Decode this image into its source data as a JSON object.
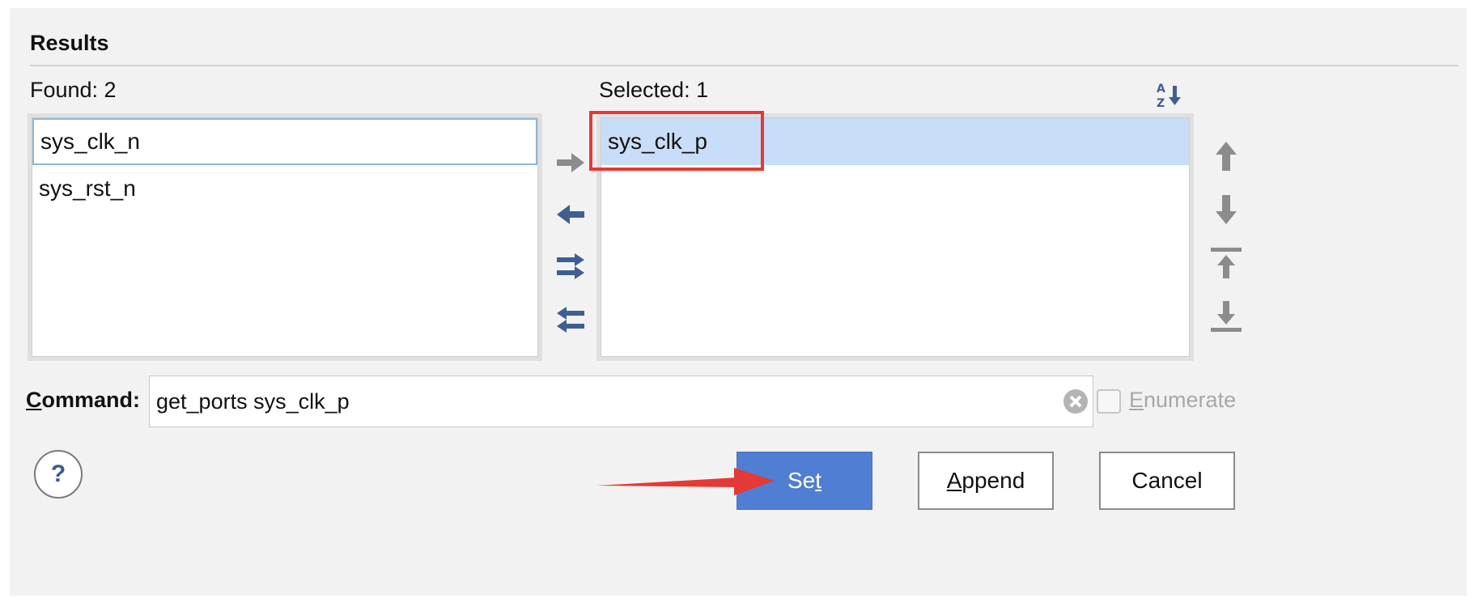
{
  "results": {
    "title": "Results",
    "found": {
      "label": "Found: 2",
      "items": [
        "sys_clk_n",
        "sys_rst_n"
      ]
    },
    "selected": {
      "label": "Selected: 1",
      "items": [
        "sys_clk_p"
      ]
    }
  },
  "command": {
    "label_prefix": "C",
    "label_rest": "ommand:",
    "value": "get_ports sys_clk_p",
    "enumerate": {
      "label_prefix": "E",
      "label_rest": "numerate",
      "checked": false
    }
  },
  "buttons": {
    "help": "?",
    "set": {
      "before": "Se",
      "mnemonic": "t",
      "after": ""
    },
    "append": {
      "mnemonic": "A",
      "after": "ppend"
    },
    "cancel": "Cancel"
  },
  "icons": {
    "move_right": "arrow-right-icon",
    "move_left": "arrow-left-icon",
    "move_all_right": "double-arrow-right-icon",
    "move_all_left": "double-arrow-left-icon",
    "sort": "sort-az-icon",
    "move_up": "arrow-up-icon",
    "move_down": "arrow-down-icon",
    "move_top": "move-to-top-icon",
    "move_bottom": "move-to-bottom-icon",
    "clear": "clear-circle-icon"
  },
  "colors": {
    "accent": "#4f7ed2",
    "selection": "#c8ddf7",
    "icon_active": "#3f5f93",
    "icon_disabled": "#8c8c8c",
    "annotation": "#e53935"
  }
}
